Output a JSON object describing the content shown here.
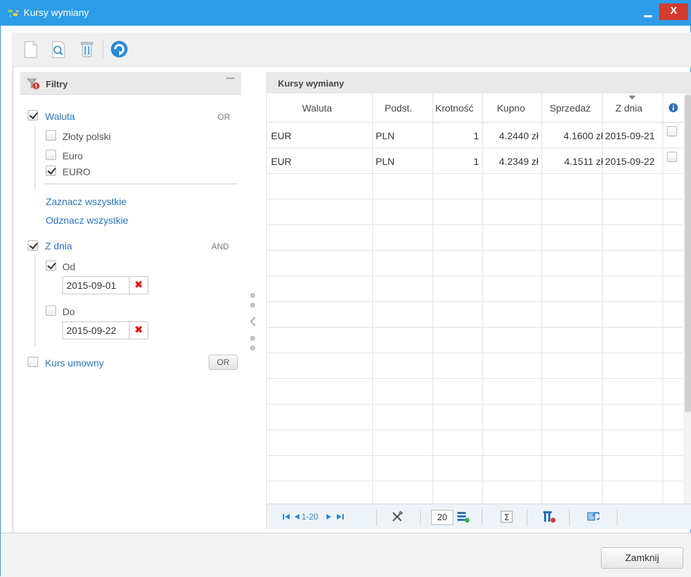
{
  "window": {
    "title": "Kursy wymiany",
    "close_glyph": "X"
  },
  "toolbar": {
    "buttons": [
      "new-document-icon",
      "preview-icon",
      "delete-icon",
      "refresh-icon"
    ]
  },
  "filters": {
    "title": "Filtry",
    "currency": {
      "label": "Waluta",
      "operator": "OR",
      "checked": true,
      "options": [
        {
          "label": "Złoty polski",
          "checked": false
        },
        {
          "label": "Euro",
          "checked": false
        },
        {
          "label": "EURO",
          "checked": true
        }
      ],
      "select_all": "Zaznacz wszystkie",
      "deselect_all": "Odznacz wszystkie"
    },
    "date": {
      "label": "Z dnia",
      "operator": "AND",
      "checked": true,
      "from_label": "Od",
      "from_checked": true,
      "from_value": "2015-09-01",
      "to_label": "Do",
      "to_checked": false,
      "to_value": "2015-09-22",
      "clear_glyph": "✖"
    },
    "contract_rate": {
      "label": "Kurs umowny",
      "checked": false,
      "operator_button": "OR"
    }
  },
  "grid": {
    "title": "Kursy wymiany",
    "columns": [
      "Waluta",
      "Podst.",
      "Krotność",
      "Kupno",
      "Sprzedaż",
      "Z dnia"
    ],
    "info_glyph": "i",
    "rows": [
      {
        "currency": "EUR",
        "base": "PLN",
        "multiplier": "1",
        "buy": "4.2440 zł",
        "sell": "4.1600 zł",
        "date": "2015-09-21"
      },
      {
        "currency": "EUR",
        "base": "PLN",
        "multiplier": "1",
        "buy": "4.2349 zł",
        "sell": "4.1511 zł",
        "date": "2015-09-22"
      }
    ],
    "pager": {
      "range": "1-20",
      "page_size": "20"
    }
  },
  "footer": {
    "close_label": "Zamknij"
  },
  "colors": {
    "titlebar": "#2d9ce8",
    "link": "#2a74c0",
    "delete": "#d11111"
  }
}
